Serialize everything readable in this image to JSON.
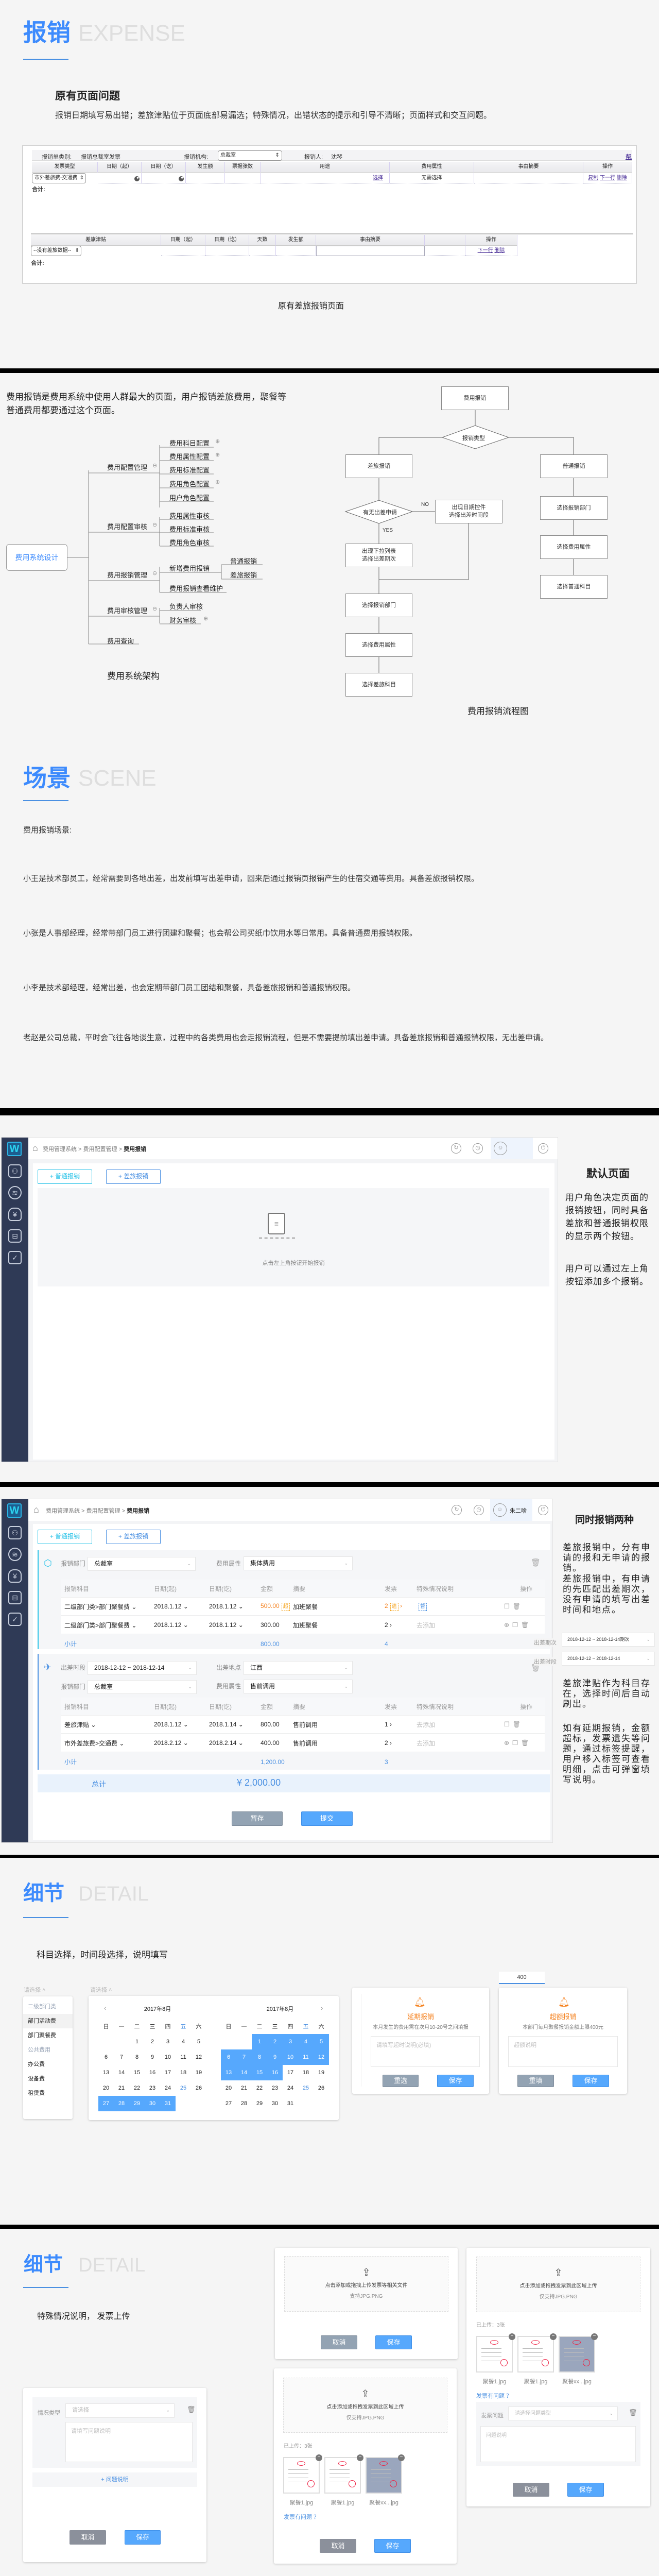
{
  "expense": {
    "title_cn": "报销",
    "title_en": "EXPENSE",
    "heading": "原有页面问题",
    "desc": "报销日期填写易出错；差旅津贴位于页面底部易漏选；特殊情况，出错状态的提示和引导不清晰；页面样式和交互问题。",
    "caption": "原有差旅报销页面"
  },
  "old_form": {
    "type_label": "报销单类别:",
    "type_value": "报销总裁室发票",
    "org_label": "报销机构:",
    "org_value": "总裁室",
    "person_label": "报销人:",
    "person_value": "沈琴",
    "help_link": "帮助",
    "columns": [
      "发票类型",
      "日期（起）",
      "日期（讫）",
      "发生额",
      "票据张数",
      "用途",
      "费用属性",
      "事由摘要",
      "操作"
    ],
    "row": {
      "invoice_type": "市外差旅费-交通费",
      "purpose_link": "选择",
      "attr": "无需选择",
      "ops": [
        "复制",
        "下一行",
        "删除"
      ]
    },
    "total_label": "合计:",
    "allowance_columns": [
      "差旅津贴",
      "日期（起）",
      "日期（讫）",
      "天数",
      "发生额",
      "事由摘要",
      "",
      "操作"
    ],
    "allowance_row": {
      "select": "--没有差旅数据--",
      "ops": [
        "下一行",
        "删除"
      ]
    },
    "allowance_total_label": "合计:"
  },
  "architecture": {
    "intro": "费用报销是费用系统中使用人群最大的页面，用户报销差旅费用，聚餐等普通费用都要通过这个页面。",
    "root": "费用系统设计",
    "branches": [
      {
        "label": "费用配置管理",
        "leaves": [
          "费用科目配置",
          "费用属性配置",
          "费用标准配置",
          "费用角色配置",
          "用户角色配置"
        ]
      },
      {
        "label": "费用配置审核",
        "leaves": [
          "费用属性审核",
          "费用标准审核",
          "费用角色审核"
        ]
      },
      {
        "label": "费用报销管理",
        "leaves": [
          "新增费用报销",
          "费用报销查看维护"
        ],
        "sub_leaves": [
          "普通报销",
          "差旅报销"
        ]
      },
      {
        "label": "费用审核管理",
        "leaves": [
          "负责人审核",
          "财务审核"
        ]
      },
      {
        "label": "费用查询",
        "leaves": []
      }
    ],
    "caption": "费用系统架构"
  },
  "flow": {
    "start": "费用报销",
    "type_decision": "报销类型",
    "travel": "差旅报销",
    "normal": "普通报销",
    "apply_decision": "有无出差申请",
    "no_label": "NO",
    "yes_label": "YES",
    "no_box": [
      "出现日期控件",
      "选择出差时间段"
    ],
    "yes_box": [
      "出现下拉列表",
      "选择出差期次"
    ],
    "travel_steps": [
      "选择报销部门",
      "选择费用属性",
      "选择差旅科目"
    ],
    "normal_steps": [
      "选择报销部门",
      "选择费用属性",
      "选择普通科目"
    ],
    "caption": "费用报销流程图"
  },
  "scene": {
    "title_cn": "场景",
    "title_en": "SCENE",
    "label": "费用报销场景:",
    "items": [
      "小王是技术部员工，经常需要到各地出差，出发前填写出差申请，回来后通过报销页报销产生的住宿交通等费用。具备差旅报销权限。",
      "小张是人事部经理，经常带部门员工进行团建和聚餐；也会帮公司买纸巾饮用水等日常用。具备普通费用报销权限。",
      "小李是技术部经理，经常出差，也会定期带部门员工团结和聚餐，具备差旅报销和普通报销权限。",
      "老赵是公司总裁，平时会飞往各地谈生意，过程中的各类费用也会走报销流程，但是不需要提前填出差申请。具备差旅报销和普通报销权限，无出差申请。"
    ]
  },
  "app": {
    "logo": "W",
    "breadcrumb": [
      "费用管理系统",
      "费用配置管理",
      "费用报销"
    ],
    "user_name": "朱二啥",
    "btn_normal": "+ 普通报销",
    "btn_travel": "+ 差旅报销",
    "empty_text": "点击左上角按钮开始报销"
  },
  "note_default": {
    "title": "默认页面",
    "p1": "用户角色决定页面的报销按钮，同时具备差旅和普通报销权限的显示两个按钮。",
    "p2": "用户可以通过左上角按钮添加多个报销。"
  },
  "report": {
    "normal": {
      "dept_label": "报销部门",
      "dept": "总裁室",
      "attr_label": "费用属性",
      "attr": "集体费用",
      "rows": [
        {
          "subject": "二级部门类>部门聚餐费",
          "from": "2018.1.12",
          "to": "2018.1.12",
          "amount": "500.00",
          "over_tag": "超",
          "summary": "加班聚餐",
          "invoices": "2",
          "lost_tag": "遗",
          "special_tag": "督"
        },
        {
          "subject": "二级部门类>部门聚餐费",
          "from": "2018.1.12",
          "to": "2018.1.12",
          "amount": "300.00",
          "summary": "加班聚餐",
          "invoices": "2",
          "special": "去添加"
        }
      ],
      "subtotal_label": "小计",
      "subtotal_amount": "800.00",
      "subtotal_invoices": "4"
    },
    "travel": {
      "period_label": "出差时段",
      "period": "2018-12-12 ~ 2018-12-14",
      "place_label": "出差地点",
      "place": "江西",
      "dept_label": "报销部门",
      "dept": "总裁室",
      "attr_label": "费用属性",
      "attr": "售前调用",
      "rows": [
        {
          "subject": "差旅津贴",
          "from": "2018.1.12",
          "to": "2018.1.14",
          "amount": "800.00",
          "summary": "售前调用",
          "invoices": "1",
          "special": "去添加"
        },
        {
          "subject": "市外差旅费>交通费",
          "from": "2018.2.12",
          "to": "2018.2.14",
          "amount": "400.00",
          "summary": "售前调用",
          "invoices": "2",
          "special": "去添加"
        }
      ],
      "subtotal_label": "小计",
      "subtotal_amount": "1,200.00",
      "subtotal_invoices": "3"
    },
    "columns": [
      "报销科目",
      "日期(起)",
      "日期(讫)",
      "金额",
      "摘要",
      "发票",
      "特殊情况说明",
      "操作"
    ],
    "total_label": "总计",
    "total_amount": "¥ 2,000.00",
    "save_draft": "暂存",
    "submit": "提交",
    "side_label_period_no": "出差期次",
    "side_label_period": "出差时段"
  },
  "note_both": {
    "title": "同时报销两种",
    "p1": "差旅报销中，分有申请的报和无申请的报销。",
    "p2": "差旅报销中，有申请的先匹配出差期次，没有申请的填写出差时间和地点。",
    "select_period_no": "2018-12-12 ~ 2018-12-14期次",
    "select_period": "2018-12-12 ~ 2018-12-14",
    "p3": "差旅津贴作为科目存在，选择时间后自动刷出。",
    "p4": "如有延期报销，金额超标，发票遗失等问题，通过标签提醒，用户移入标签可查看明细，点击可弹窗填写说明。"
  },
  "detail1": {
    "title_cn": "细节",
    "title_en": "DETAIL",
    "subtitle": "科目选择，时间段选择，说明填写",
    "select_label": "请选择",
    "subject_options": [
      {
        "label": "二级部门类",
        "group": true
      },
      {
        "label": "部门活动费",
        "hover": true
      },
      {
        "label": "部门聚餐费"
      },
      {
        "label": "公共费用",
        "group": true
      },
      {
        "label": "办公费"
      },
      {
        "label": "设备费"
      },
      {
        "label": "租赁费"
      }
    ],
    "weekdays": [
      "日",
      "一",
      "二",
      "三",
      "四",
      "五",
      "六"
    ],
    "calendars": [
      {
        "title": "2017年8月",
        "first_weekday": 2,
        "days": 31,
        "selected_from": 27,
        "selected_to": 31
      },
      {
        "title": "2017年8月",
        "first_weekday": 2,
        "days": 31,
        "selected_from": 1,
        "selected_to": 16
      }
    ],
    "highlight_day": 25,
    "delay": {
      "title": "延期报销",
      "desc": "本月发生的费用需在次月10-20号之间填报",
      "placeholder": "请填写超时说明(必填)",
      "reset": "重选",
      "save": "保存"
    },
    "amount_input": "400",
    "over": {
      "title": "超额报销",
      "desc": "本部门每月聚餐报销金额上限400元",
      "placeholder": "超额说明",
      "reset": "重填",
      "save": "保存"
    },
    "accent_orange": "#f5821f",
    "accent_blue": "#56a8fd"
  },
  "detail2": {
    "title_cn": "细节",
    "title_en": "DETAIL",
    "subtitle": "特殊情况说明， 发票上传",
    "situation_label": "情况类型",
    "situation_placeholder": "请选择",
    "problem_placeholder": "请填写问题说明",
    "add_problem": "+ 问题说明",
    "cancel": "取消",
    "save": "保存",
    "upload1": {
      "text": "点击添加或拖拽上传发票等相关文件",
      "hint": "支持JPG.PNG"
    },
    "upload2": {
      "text": "点击添加或拖拽发票到此区域上传",
      "hint": "仅支持JPG.PNG"
    },
    "uploaded": "已上传：3张",
    "files": [
      "聚餐1.jpg",
      "聚餐1.jpg",
      "聚餐xx...jpg"
    ],
    "invoice_problem": "发票有问题 ？",
    "invoice_issue_label": "发票问题",
    "issue_placeholder": "请选择问题类型",
    "issue_desc_placeholder": "问题说明"
  }
}
